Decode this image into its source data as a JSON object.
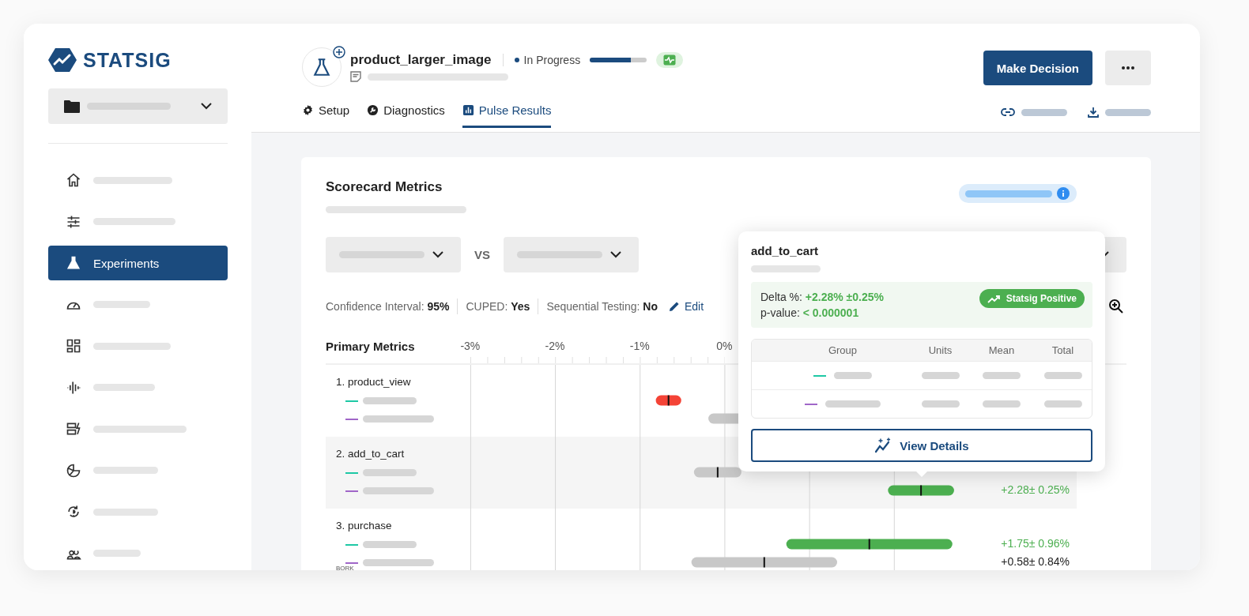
{
  "sidebar": {
    "logo": "STATSIG",
    "items": [
      {
        "selected": false
      },
      {
        "selected": false
      },
      {
        "label": "Experiments",
        "selected": true
      },
      {
        "selected": false
      },
      {
        "selected": false
      },
      {
        "selected": false
      },
      {
        "selected": false
      },
      {
        "selected": false
      },
      {
        "selected": false
      },
      {
        "selected": false
      }
    ]
  },
  "header": {
    "title": "product_larger_image",
    "status": "In Progress",
    "progress": {
      "level": 0.72
    },
    "primary_button": "Make Decision",
    "tabs": [
      {
        "label": "Setup",
        "selected": false
      },
      {
        "label": "Diagnostics",
        "selected": false
      },
      {
        "label": "Pulse Results",
        "selected": true
      }
    ]
  },
  "scorecard": {
    "title": "Scorecard Metrics",
    "compare_label": "VS",
    "settings": [
      "Confidence Interval: **95%**",
      "CUPED: **Yes**",
      "Sequential Testing: **No**"
    ],
    "edit_link": "Edit",
    "section_title": "Primary Metrics",
    "axis_labels": [
      "-3%",
      "-2%",
      "-1%",
      "0%"
    ],
    "metrics": [
      {
        "name": "1. product_view",
        "lines": [
          {
            "color": "#1ec8a5"
          },
          {
            "color": "#a066c8"
          }
        ]
      },
      {
        "name": "2. add_to_cart",
        "lines": [
          {
            "color": "#1ec8a5"
          },
          {
            "color": "#a066c8",
            "value": "+2.28± 0.25%",
            "positive": true
          }
        ]
      },
      {
        "name": "3. purchase",
        "tag": "BORK",
        "lines": [
          {
            "color": "#1ec8a5",
            "value": "+1.75± 0.96%",
            "positive": true
          },
          {
            "color": "#a066c8",
            "value": "+0.58± 0.84%",
            "positive": false
          }
        ]
      }
    ]
  },
  "popover": {
    "title": "add_to_cart",
    "delta_label": "Delta %:",
    "delta": "+2.28% ±0.25%",
    "pvalue_label": "p-value:",
    "pvalue": "< 0.000001",
    "badge": "Statsig Positive",
    "columns": [
      "Group",
      "Units",
      "Mean",
      "Total"
    ],
    "rows": [
      {
        "color": "#1ec8a5"
      },
      {
        "color": "#a066c8"
      }
    ],
    "button": "View Details"
  }
}
